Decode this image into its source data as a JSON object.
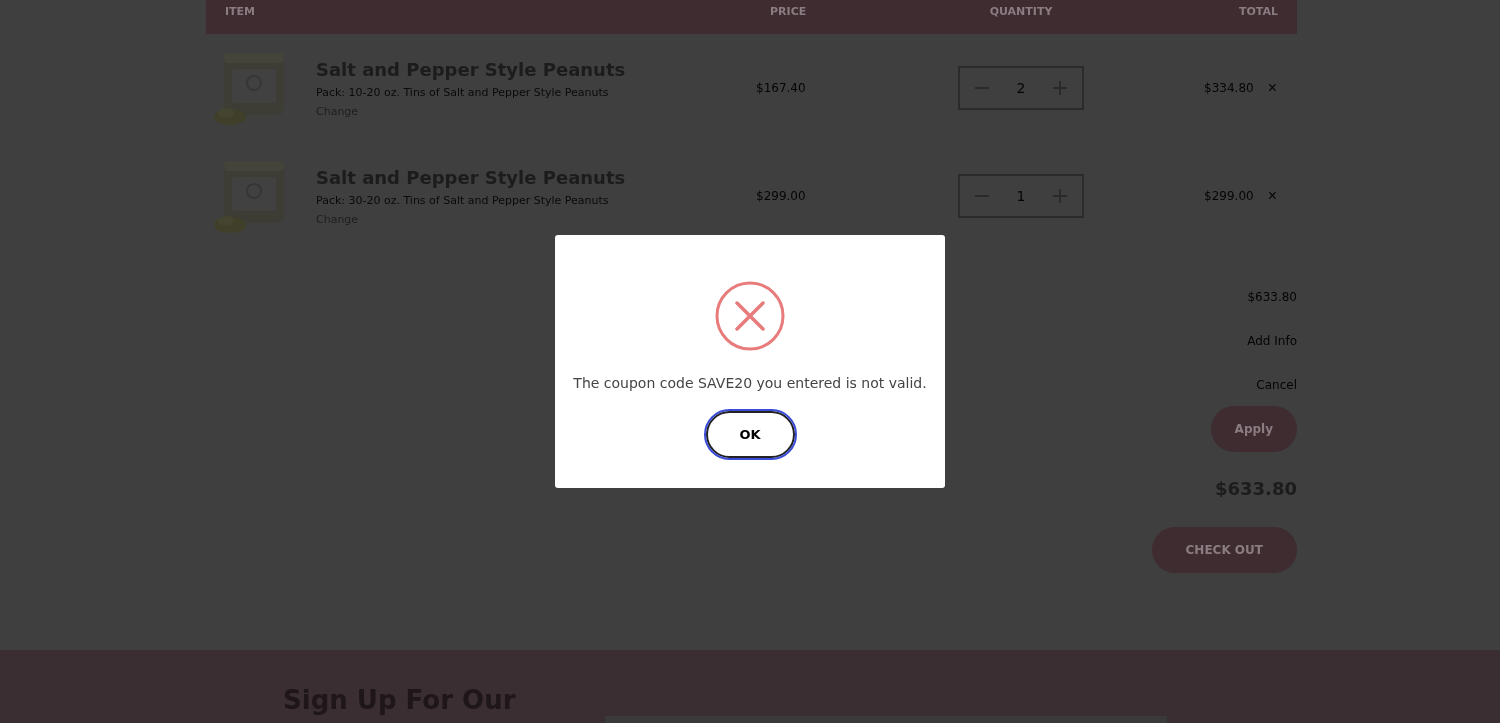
{
  "cart": {
    "columns": [
      "ITEM",
      "PRICE",
      "QUANTITY",
      "TOTAL"
    ],
    "rows": [
      {
        "name": "Salt and Pepper Style Peanuts",
        "description": "Pack: 10-20 oz. Tins of Salt and Pepper Style Peanuts",
        "change": "Change",
        "price": "$167.40",
        "quantity": "2",
        "total": "$334.80",
        "remove": "×"
      },
      {
        "name": "Salt and Pepper Style Peanuts",
        "description": "Pack: 30-20 oz. Tins of Salt and Pepper Style Peanuts",
        "change": "Change",
        "price": "$299.00",
        "quantity": "1",
        "total": "$299.00",
        "remove": "×"
      }
    ]
  },
  "summary": {
    "subtotal": "$633.80",
    "add_info": "Add Info",
    "cancel": "Cancel",
    "apply": "Apply",
    "total": "$633.80",
    "checkout": "CHECK OUT"
  },
  "footer": {
    "heading": "Sign Up For Our"
  },
  "dialog": {
    "message": "The coupon code SAVE20 you entered is not valid.",
    "button": "OK"
  }
}
